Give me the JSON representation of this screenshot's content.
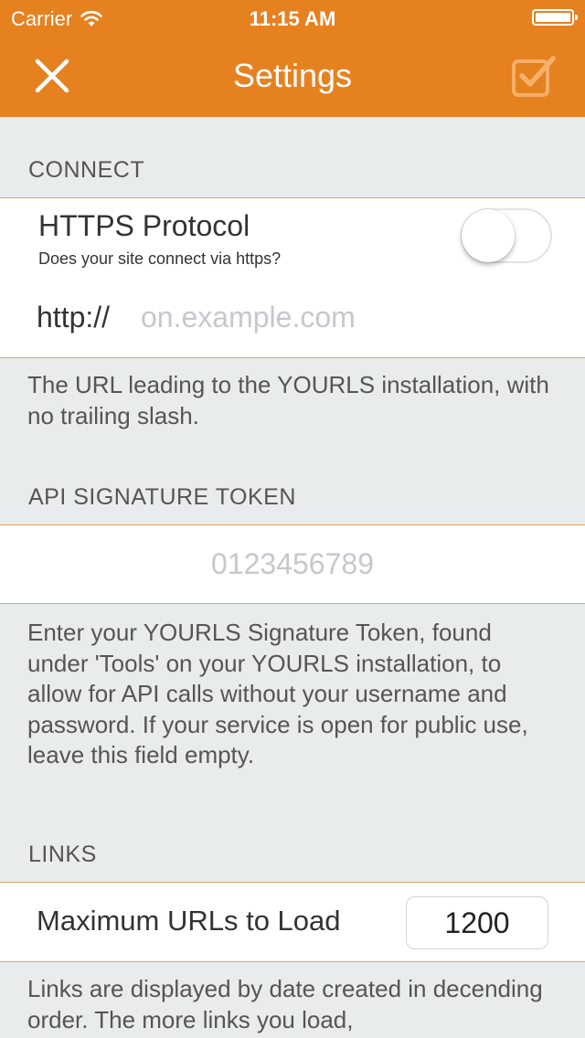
{
  "status_bar": {
    "carrier": "Carrier",
    "time": "11:15 AM"
  },
  "nav": {
    "title": "Settings",
    "close_icon": "close-icon",
    "done_icon": "checkbox-check-icon"
  },
  "colors": {
    "accent": "#e68120",
    "background": "#e8ecec",
    "separator": "#e6a15a"
  },
  "connect": {
    "header": "CONNECT",
    "https": {
      "title": "HTTPS Protocol",
      "subtitle": "Does your site connect via https?",
      "enabled": false
    },
    "url": {
      "prefix": "http://",
      "value": "",
      "placeholder": "on.example.com"
    },
    "footer": "The URL leading to the YOURLS installation, with no trailing slash."
  },
  "api": {
    "header": "API SIGNATURE TOKEN",
    "token": {
      "value": "",
      "placeholder": "0123456789"
    },
    "footer": "Enter your YOURLS Signature Token, found under 'Tools' on your YOURLS installation, to allow for API calls without your username and password. If your service is open for public use, leave this field empty."
  },
  "links": {
    "header": "LINKS",
    "max_urls": {
      "label": "Maximum URLs to Load",
      "value": "1200"
    },
    "footer": "Links are displayed by date created in decending order. The more links you load,"
  }
}
